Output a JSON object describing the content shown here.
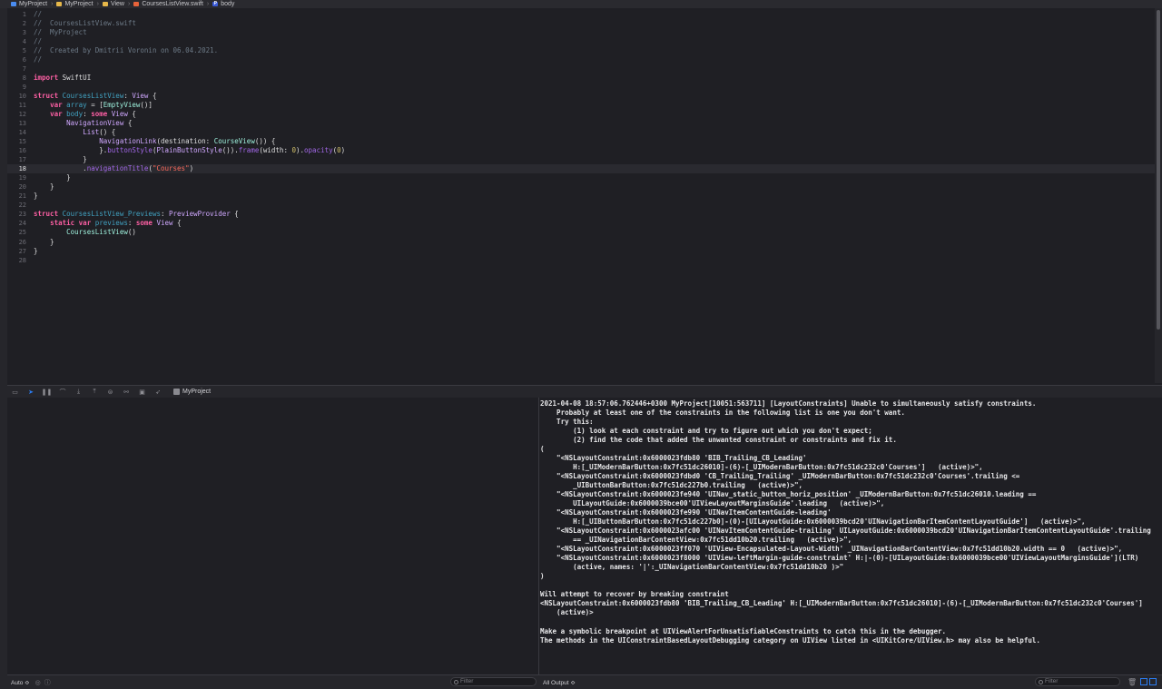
{
  "jumpbar": {
    "crumbs": [
      "MyProject",
      "MyProject",
      "View",
      "CoursesListView.swift",
      "body"
    ],
    "crumb_icons": [
      "project-icon",
      "folder-icon",
      "folder-icon",
      "swift-file-icon",
      "property-icon"
    ],
    "prop_badge": "P"
  },
  "editor": {
    "current_line": 18,
    "line_numbers": [
      "1",
      "2",
      "3",
      "4",
      "5",
      "6",
      "7",
      "8",
      "9",
      "10",
      "11",
      "12",
      "13",
      "14",
      "15",
      "16",
      "17",
      "18",
      "19",
      "20",
      "21",
      "22",
      "23",
      "24",
      "25",
      "26",
      "27",
      "28"
    ],
    "lines": [
      [
        [
          "c-com",
          "//"
        ]
      ],
      [
        [
          "c-com",
          "//  CoursesListView.swift"
        ]
      ],
      [
        [
          "c-com",
          "//  MyProject"
        ]
      ],
      [
        [
          "c-com",
          "//"
        ]
      ],
      [
        [
          "c-com",
          "//  Created by Dmitrii Voronin on 06.04.2021."
        ]
      ],
      [
        [
          "c-com",
          "//"
        ]
      ],
      [],
      [
        [
          "c-kw",
          "import"
        ],
        [
          "",
          " SwiftUI"
        ]
      ],
      [],
      [
        [
          "c-kw",
          "struct"
        ],
        [
          "",
          " "
        ],
        [
          "c-decl",
          "CoursesListView"
        ],
        [
          "",
          ": "
        ],
        [
          "c-other",
          "View"
        ],
        [
          "",
          " {"
        ]
      ],
      [
        [
          "",
          "    "
        ],
        [
          "c-kw",
          "var"
        ],
        [
          "",
          " "
        ],
        [
          "c-decl",
          "array"
        ],
        [
          "",
          " = ["
        ],
        [
          "c-id",
          "EmptyView"
        ],
        [
          "",
          "()]"
        ]
      ],
      [
        [
          "",
          "    "
        ],
        [
          "c-kw",
          "var"
        ],
        [
          "",
          " "
        ],
        [
          "c-decl",
          "body"
        ],
        [
          "",
          ": "
        ],
        [
          "c-kw",
          "some"
        ],
        [
          "",
          " "
        ],
        [
          "c-other",
          "View"
        ],
        [
          "",
          " {"
        ]
      ],
      [
        [
          "",
          "        "
        ],
        [
          "c-other",
          "NavigationView"
        ],
        [
          "",
          " {"
        ]
      ],
      [
        [
          "",
          "            "
        ],
        [
          "c-other",
          "List"
        ],
        [
          "",
          "() {"
        ]
      ],
      [
        [
          "",
          "                "
        ],
        [
          "c-other",
          "NavigationLink"
        ],
        [
          "",
          "(destination: "
        ],
        [
          "c-id",
          "CourseView"
        ],
        [
          "",
          "()) {"
        ]
      ],
      [
        [
          "",
          "                }."
        ],
        [
          "c-prop",
          "buttonStyle"
        ],
        [
          "",
          "("
        ],
        [
          "c-other",
          "PlainButtonStyle"
        ],
        [
          "",
          "())."
        ],
        [
          "c-prop",
          "frame"
        ],
        [
          "",
          "(width: "
        ],
        [
          "c-num",
          "0"
        ],
        [
          "",
          ")."
        ],
        [
          "c-prop",
          "opacity"
        ],
        [
          "",
          "("
        ],
        [
          "c-num",
          "0"
        ],
        [
          "",
          ")"
        ]
      ],
      [
        [
          "",
          "            }"
        ]
      ],
      [
        [
          "",
          "            ."
        ],
        [
          "c-prop",
          "navigationTitle"
        ],
        [
          "",
          "("
        ],
        [
          "c-str",
          "\"Courses\""
        ],
        [
          "",
          ")"
        ]
      ],
      [
        [
          "",
          "        }"
        ]
      ],
      [
        [
          "",
          "    }"
        ]
      ],
      [
        [
          "",
          "}"
        ]
      ],
      [],
      [
        [
          "c-kw",
          "struct"
        ],
        [
          "",
          " "
        ],
        [
          "c-decl",
          "CoursesListView_Previews"
        ],
        [
          "",
          ": "
        ],
        [
          "c-other",
          "PreviewProvider"
        ],
        [
          "",
          " {"
        ]
      ],
      [
        [
          "",
          "    "
        ],
        [
          "c-kw",
          "static"
        ],
        [
          "",
          " "
        ],
        [
          "c-kw",
          "var"
        ],
        [
          "",
          " "
        ],
        [
          "c-decl",
          "previews"
        ],
        [
          "",
          ": "
        ],
        [
          "c-kw",
          "some"
        ],
        [
          "",
          " "
        ],
        [
          "c-other",
          "View"
        ],
        [
          "",
          " {"
        ]
      ],
      [
        [
          "",
          "        "
        ],
        [
          "c-id",
          "CoursesListView"
        ],
        [
          "",
          "()"
        ]
      ],
      [
        [
          "",
          "    }"
        ]
      ],
      [
        [
          "",
          "}"
        ]
      ],
      []
    ]
  },
  "debugbar": {
    "buttons": [
      "hide-debug-area-icon",
      "breakpoints-toggle-icon",
      "pause-icon",
      "step-over-icon",
      "step-into-icon",
      "step-out-icon",
      "debug-view-hierarchy-icon",
      "memory-graph-icon",
      "environment-overrides-icon",
      "simulate-location-icon"
    ],
    "target": "MyProject"
  },
  "console": {
    "lines": [
      "2021-04-08 18:57:06.762446+0300 MyProject[10051:563711] [LayoutConstraints] Unable to simultaneously satisfy constraints.",
      "    Probably at least one of the constraints in the following list is one you don't want.",
      "    Try this:",
      "        (1) look at each constraint and try to figure out which you don't expect;",
      "        (2) find the code that added the unwanted constraint or constraints and fix it.",
      "(",
      "    \"<NSLayoutConstraint:0x6000023fdb80 'BIB_Trailing_CB_Leading'",
      "        H:[_UIModernBarButton:0x7fc51dc26010]-(6)-[_UIModernBarButton:0x7fc51dc232c0'Courses']   (active)>\",",
      "    \"<NSLayoutConstraint:0x6000023fdbd0 'CB_Trailing_Trailing' _UIModernBarButton:0x7fc51dc232c0'Courses'.trailing <=",
      "        _UIButtonBarButton:0x7fc51dc227b0.trailing   (active)>\",",
      "    \"<NSLayoutConstraint:0x6000023fe940 'UINav_static_button_horiz_position' _UIModernBarButton:0x7fc51dc26010.leading ==",
      "        UILayoutGuide:0x6000039bce00'UIViewLayoutMarginsGuide'.leading   (active)>\",",
      "    \"<NSLayoutConstraint:0x6000023fe990 'UINavItemContentGuide-leading'",
      "        H:[_UIButtonBarButton:0x7fc51dc227b0]-(0)-[UILayoutGuide:0x6000039bcd20'UINavigationBarItemContentLayoutGuide']   (active)>\",",
      "    \"<NSLayoutConstraint:0x6000023afc00 'UINavItemContentGuide-trailing' UILayoutGuide:0x6000039bcd20'UINavigationBarItemContentLayoutGuide'.trailing",
      "        == _UINavigationBarContentView:0x7fc51dd10b20.trailing   (active)>\",",
      "    \"<NSLayoutConstraint:0x6000023ff070 'UIView-Encapsulated-Layout-Width' _UINavigationBarContentView:0x7fc51dd10b20.width == 0   (active)>\",",
      "    \"<NSLayoutConstraint:0x6000023f8000 'UIView-leftMargin-guide-constraint' H:|-(0)-[UILayoutGuide:0x6000039bce00'UIViewLayoutMarginsGuide'](LTR)",
      "        (active, names: '|':_UINavigationBarContentView:0x7fc51dd10b20 )>\"",
      ")",
      "",
      "Will attempt to recover by breaking constraint",
      "<NSLayoutConstraint:0x6000023fdb80 'BIB_Trailing_CB_Leading' H:[_UIModernBarButton:0x7fc51dc26010]-(6)-[_UIModernBarButton:0x7fc51dc232c0'Courses']",
      "    (active)>",
      "",
      "Make a symbolic breakpoint at UIViewAlertForUnsatisfiableConstraints to catch this in the debugger.",
      "The methods in the UIConstraintBasedLayoutDebugging category on UIView listed in <UIKitCore/UIView.h> may also be helpful."
    ]
  },
  "bottom_left": {
    "scope_select": "Auto ≎",
    "filter_placeholder": "Filter"
  },
  "bottom_right": {
    "output_select": "All Output ≎",
    "filter_placeholder": "Filter"
  },
  "colors": {
    "background": "#1f1f24",
    "accent": "#2b7df2",
    "keyword": "#fc5fa3",
    "comment": "#6c7986",
    "string": "#fc6a5d"
  }
}
